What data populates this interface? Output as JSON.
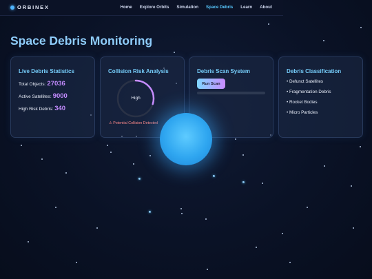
{
  "brand": {
    "name": "ORBINEX"
  },
  "nav": {
    "items": [
      "Home",
      "Explore Orbits",
      "Simulation",
      "Space Debris",
      "Learn",
      "About"
    ],
    "active": "Space Debris"
  },
  "page": {
    "title": "Space Debris Monitoring"
  },
  "stats": {
    "title": "Live Debris Statistics",
    "total_label": "Total Objects:",
    "total_value": "27036",
    "active_label": "Active Satellites:",
    "active_value": "9000",
    "risk_label": "High Risk Debris:",
    "risk_value": "340"
  },
  "collision": {
    "title": "Collision Risk Analysis",
    "level": "High",
    "gauge_fraction": 0.3,
    "warning": "⚠ Potential Collision Detected"
  },
  "scan": {
    "title": "Debris Scan System",
    "button": "Run Scan",
    "progress": 0
  },
  "classification": {
    "title": "Debris Classification",
    "items": [
      "Defunct Satellites",
      "Fragmentation Debris",
      "Rocket Bodies",
      "Micro Particles"
    ]
  },
  "colors": {
    "accent": "#58c8ff",
    "value": "#c58cff",
    "warning": "#ff8a8a",
    "title": "#8fcdfb",
    "planet": "#2fa6f0"
  }
}
